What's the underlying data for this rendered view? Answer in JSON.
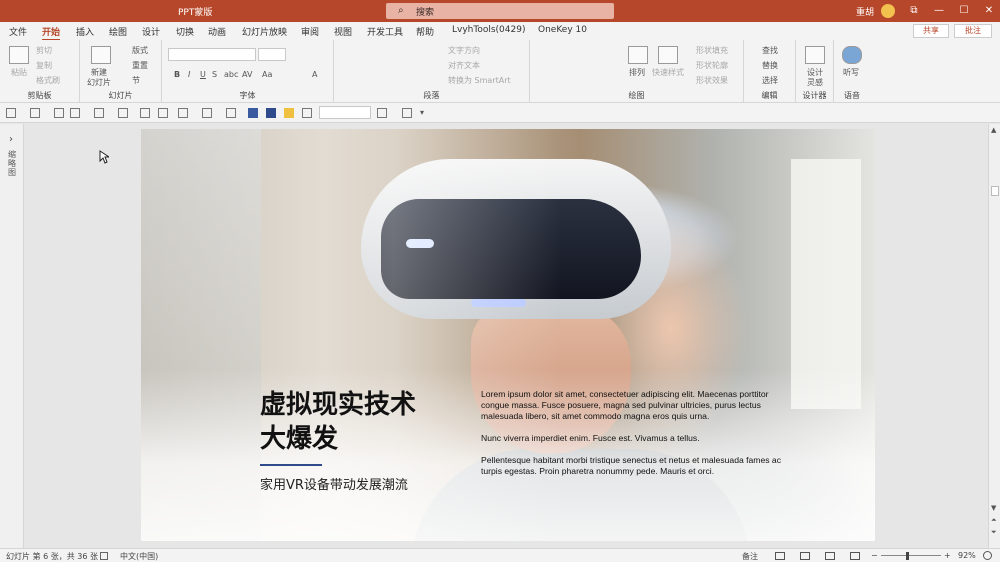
{
  "titlebar": {
    "title": "PPT蒙版",
    "search_placeholder": "搜索",
    "user": "重胡",
    "min": "—",
    "restore": "☐",
    "close": "✕",
    "ribbon_display": "⧉"
  },
  "menu": {
    "tabs": [
      "文件",
      "开始",
      "插入",
      "绘图",
      "设计",
      "切换",
      "动画",
      "幻灯片放映",
      "审阅",
      "视图",
      "开发工具",
      "帮助",
      "LvyhTools(0429)",
      "OneKey 10"
    ],
    "active": "开始",
    "share": "共享",
    "comments": "批注"
  },
  "ribbon": {
    "clipboard": {
      "label": "剪贴板",
      "paste": "粘贴",
      "cut": "剪切",
      "copy": "复制",
      "format_painter": "格式刷"
    },
    "slides": {
      "label": "幻灯片",
      "new_slide": "新建",
      "new_slide2": "幻灯片",
      "layout": "版式",
      "reset": "重置",
      "section": "节"
    },
    "font": {
      "label": "字体",
      "bold": "B",
      "italic": "I",
      "underline": "U",
      "strike": "S",
      "shadow": "abc",
      "spacing": "AV",
      "case": "Aa",
      "color": "A"
    },
    "paragraph": {
      "label": "段落",
      "text_direction": "文字方向",
      "align_text": "对齐文本",
      "smartart": "转换为 SmartArt"
    },
    "drawing": {
      "label": "绘图",
      "arrange": "排列",
      "quick_styles": "快速样式",
      "fill": "形状填充",
      "outline": "形状轮廓",
      "effects": "形状效果"
    },
    "editing": {
      "label": "编辑",
      "find": "查找",
      "replace": "替换",
      "select": "选择"
    },
    "designer": {
      "label": "设计器",
      "ideas": "设计",
      "ideas2": "灵感"
    },
    "voice": {
      "label": "语音",
      "dictate": "听写"
    }
  },
  "leftpane": {
    "label": "缩略图"
  },
  "slide": {
    "title_line1": "虚拟现实技术",
    "title_line2": "大爆发",
    "subtitle": "家用VR设备带动发展潮流",
    "body": [
      "Lorem ipsum dolor sit amet, consectetuer adipiscing elit. Maecenas porttitor congue massa. Fusce posuere, magna sed pulvinar ultricies, purus lectus malesuada libero, sit amet commodo magna eros quis urna.",
      "Nunc viverra imperdiet enim. Fusce est. Vivamus a tellus.",
      "Pellentesque habitant morbi tristique senectus et netus et malesuada fames ac turpis egestas. Proin pharetra nonummy pede. Mauris et orci."
    ]
  },
  "status": {
    "slide_info": "幻灯片 第 6 张，共 36 张",
    "language": "中文(中国)",
    "notes": "备注",
    "zoom_minus": "−",
    "zoom_plus": "+",
    "zoom": "92%"
  },
  "colors": {
    "accent": "#b7472a",
    "title_underline": "#2f4b8c"
  }
}
